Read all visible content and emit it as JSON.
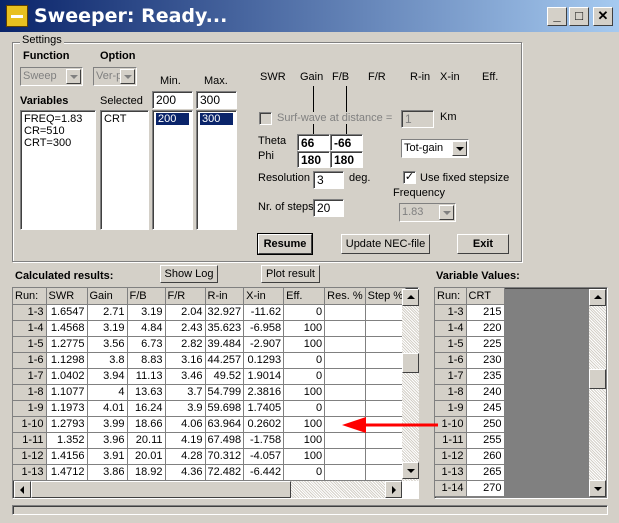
{
  "window": {
    "title": "Sweeper: Ready...",
    "minimize": "_",
    "maximize": "□",
    "close": "✕"
  },
  "settings": {
    "group_label": "Settings",
    "function_label": "Function",
    "option_label": "Option",
    "function_value": "Sweep",
    "option_value": "Ver-p",
    "variables_label": "Variables",
    "variables": [
      "FREQ=1.83",
      "CR=510",
      "CRT=300"
    ],
    "selected_label": "Selected",
    "selected": [
      "CRT"
    ],
    "min_label": "Min.",
    "max_label": "Max.",
    "min_value": "200",
    "max_value": "300",
    "min_list": [
      "200"
    ],
    "max_list": [
      "300"
    ]
  },
  "params": {
    "headers": [
      "SWR",
      "Gain",
      "F/B",
      "F/R",
      "R-in",
      "X-in",
      "Eff."
    ],
    "surf_wave_label": "Surf-wave at distance =",
    "surf_wave_value": "1",
    "km_label": "Km",
    "theta_label": "Theta",
    "phi_label": "Phi",
    "theta_1": "66",
    "theta_2": "-66",
    "phi_1": "180",
    "phi_2": "180",
    "gain_type": "Tot-gain",
    "resolution_label": "Resolution",
    "resolution_value": "3",
    "deg_label": "deg.",
    "fixed_step_label": "Use fixed stepsize",
    "fixed_step_checked": "✓",
    "frequency_label": "Frequency",
    "frequency_value": "1.83",
    "steps_label": "Nr. of steps",
    "steps_value": "20"
  },
  "buttons": {
    "resume": "Resume",
    "update_nec": "Update NEC-file",
    "exit": "Exit",
    "show_log": "Show Log",
    "plot_result": "Plot result"
  },
  "results": {
    "label": "Calculated results:",
    "columns": [
      "Run:",
      "SWR",
      "Gain",
      "F/B",
      "F/R",
      "R-in",
      "X-in",
      "Eff.",
      "Res. %",
      "Step %"
    ],
    "rows": [
      [
        "1-3",
        "1.6547",
        "2.71",
        "3.19",
        "2.04",
        "32.927",
        "-11.62",
        "0",
        "",
        ""
      ],
      [
        "1-4",
        "1.4568",
        "3.19",
        "4.84",
        "2.43",
        "35.623",
        "-6.958",
        "100",
        "",
        ""
      ],
      [
        "1-5",
        "1.2775",
        "3.56",
        "6.73",
        "2.82",
        "39.484",
        "-2.907",
        "100",
        "",
        ""
      ],
      [
        "1-6",
        "1.1298",
        "3.8",
        "8.83",
        "3.16",
        "44.257",
        "0.1293",
        "0",
        "",
        ""
      ],
      [
        "1-7",
        "1.0402",
        "3.94",
        "11.13",
        "3.46",
        "49.52",
        "1.9014",
        "0",
        "",
        ""
      ],
      [
        "1-8",
        "1.1077",
        "4",
        "13.63",
        "3.7",
        "54.799",
        "2.3816",
        "100",
        "",
        ""
      ],
      [
        "1-9",
        "1.1973",
        "4.01",
        "16.24",
        "3.9",
        "59.698",
        "1.7405",
        "0",
        "",
        ""
      ],
      [
        "1-10",
        "1.2793",
        "3.99",
        "18.66",
        "4.06",
        "63.964",
        "0.2602",
        "100",
        "",
        ""
      ],
      [
        "1-11",
        "1.352",
        "3.96",
        "20.11",
        "4.19",
        "67.498",
        "-1.758",
        "100",
        "",
        ""
      ],
      [
        "1-12",
        "1.4156",
        "3.91",
        "20.01",
        "4.28",
        "70.312",
        "-4.057",
        "100",
        "",
        ""
      ],
      [
        "1-13",
        "1.4712",
        "3.86",
        "18.92",
        "4.36",
        "72.482",
        "-6.442",
        "0",
        "",
        ""
      ]
    ]
  },
  "variable_values": {
    "label": "Variable Values:",
    "columns": [
      "Run:",
      "CRT"
    ],
    "rows": [
      [
        "1-3",
        "215"
      ],
      [
        "1-4",
        "220"
      ],
      [
        "1-5",
        "225"
      ],
      [
        "1-6",
        "230"
      ],
      [
        "1-7",
        "235"
      ],
      [
        "1-8",
        "240"
      ],
      [
        "1-9",
        "245"
      ],
      [
        "1-10",
        "250"
      ],
      [
        "1-11",
        "255"
      ],
      [
        "1-12",
        "260"
      ],
      [
        "1-13",
        "265"
      ],
      [
        "1-14",
        "270"
      ]
    ]
  },
  "colors": {
    "title_start": "#0a246a",
    "title_end": "#a6caf0",
    "arrow": "#ff0000",
    "face": "#d4d0c8"
  }
}
